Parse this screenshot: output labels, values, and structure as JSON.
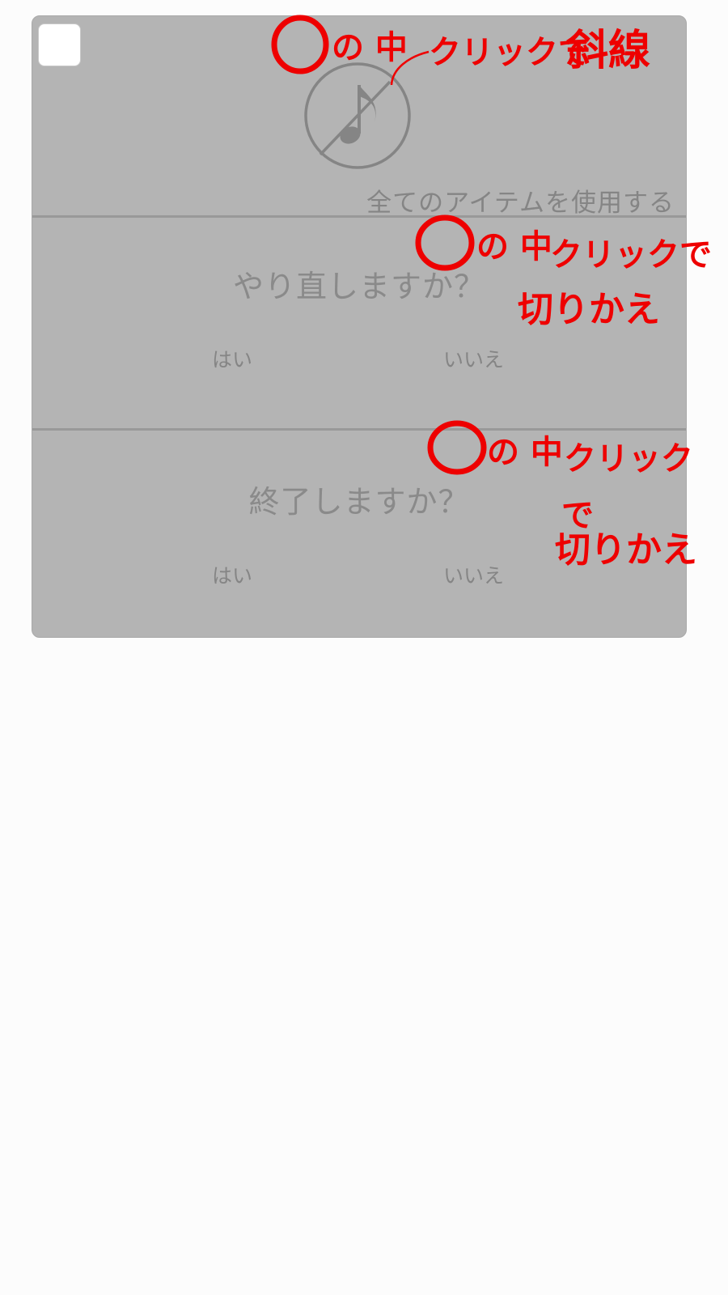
{
  "settings_panel": {
    "sound_icon": "music-note-muted-icon",
    "use_all_items_label": "全てのアイテムを使用する",
    "retry": {
      "question": "やり直しますか？",
      "yes_label": "はい",
      "no_label": "いいえ"
    },
    "quit": {
      "question": "終了しますか？",
      "yes_label": "はい",
      "no_label": "いいえ"
    }
  },
  "annotations": {
    "note_1": {
      "label": "の 中",
      "action": "クリックで",
      "result": "斜線"
    },
    "note_2": {
      "label": "の 中",
      "action": "クリックで",
      "result": "切りかえ"
    },
    "note_3": {
      "label": "の 中",
      "action": "クリック",
      "connector": "で",
      "result": "切りかえ"
    },
    "color": "#ee0000"
  },
  "colors": {
    "panel_background": "#b4b4b4",
    "page_background": "#fcfcfc",
    "text_gray": "#8a8a8a",
    "annotation_red": "#ee0000"
  }
}
